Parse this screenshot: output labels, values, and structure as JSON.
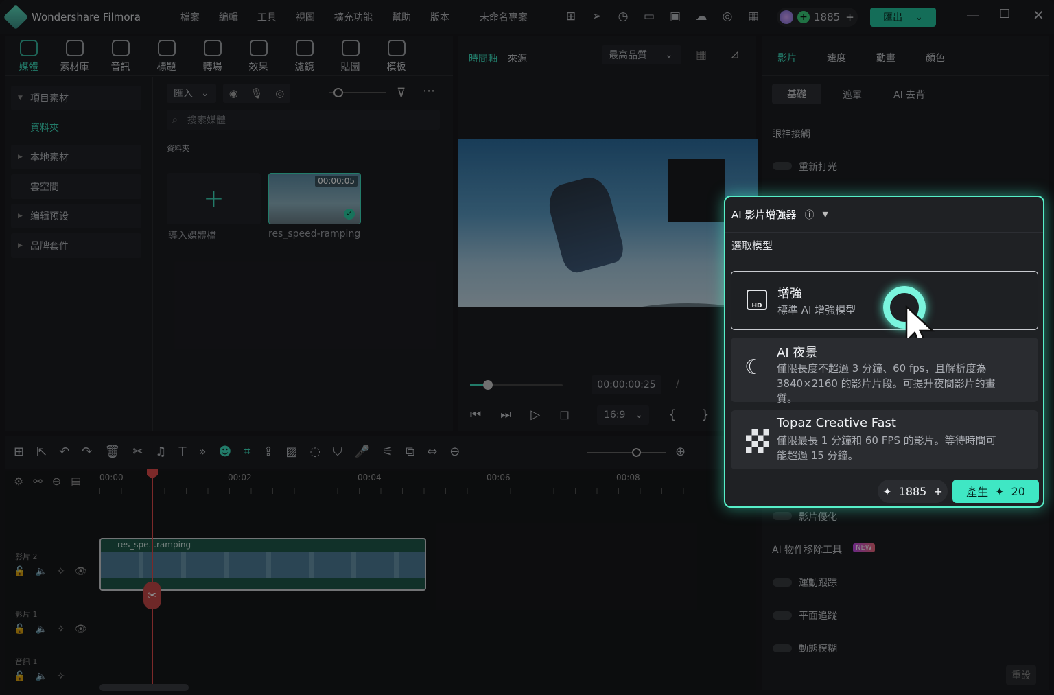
{
  "app": {
    "name": "Wondershare Filmora",
    "project": "未命名專案"
  },
  "menu": [
    "檔案",
    "編輯",
    "工具",
    "視圖",
    "擴充功能",
    "幫助",
    "版本"
  ],
  "account": {
    "credits": "1885",
    "export_label": "匯出"
  },
  "tools": [
    {
      "label": "媒體",
      "icon": "media-icon"
    },
    {
      "label": "素材庫",
      "icon": "store-icon"
    },
    {
      "label": "音訊",
      "icon": "music-icon"
    },
    {
      "label": "標題",
      "icon": "title-icon"
    },
    {
      "label": "轉場",
      "icon": "transition-icon"
    },
    {
      "label": "效果",
      "icon": "effects-icon"
    },
    {
      "label": "濾鏡",
      "icon": "filter-icon"
    },
    {
      "label": "貼圖",
      "icon": "sticker-icon"
    },
    {
      "label": "模板",
      "icon": "template-icon"
    }
  ],
  "sidebar": [
    "項目素材",
    "資料夾",
    "本地素材",
    "雲空間",
    "编辑预设",
    "品牌套件"
  ],
  "media": {
    "import_label": "匯入",
    "search_placeholder": "搜索媒體",
    "folder_label": "資料夾",
    "import_tile": "導入媒體檔",
    "clip_name": "res_speed-ramping",
    "clip_duration": "00:00:05"
  },
  "preview": {
    "tab_timeline": "時間軸",
    "tab_source": "來源",
    "quality": "最高品質",
    "timecode": "00:00:00:25",
    "sep": "/",
    "ratio": "16:9"
  },
  "props": {
    "tabs": [
      "影片",
      "速度",
      "動畫",
      "顏色"
    ],
    "subtabs": [
      "基礎",
      "遮罩",
      "AI 去背"
    ],
    "section_eye": "眼神接觸",
    "relight": "重新打光",
    "enhance": "影片優化",
    "object_removal": "AI 物件移除工具",
    "new_badge": "NEW",
    "motion_track": "運動跟踪",
    "planar_track": "平面追蹤",
    "motion_blur": "動態模糊",
    "reset": "重設"
  },
  "timeline": {
    "ticks": [
      "00:00",
      "00:02",
      "00:04",
      "00:06",
      "00:08"
    ],
    "tracks": [
      "影片 2",
      "影片 1",
      "音訊 1"
    ],
    "clip_label": "res_spe...ramping"
  },
  "popup": {
    "title": "AI 影片增強器",
    "choose": "選取模型",
    "opt1_title": "增強",
    "opt1_desc": "標準 AI 增強模型",
    "opt2_title": "AI 夜景",
    "opt2_desc": "僅限長度不超過 3 分鐘、60 fps，且解析度為 3840×2160 的影片片段。可提升夜間影片的畫質。",
    "opt3_title": "Topaz Creative Fast",
    "opt3_desc": "僅限最長 1 分鐘和 60 FPS 的影片。等待時間可能超過 15 分鐘。",
    "credits": "1885",
    "generate": "產生",
    "cost": "20"
  }
}
